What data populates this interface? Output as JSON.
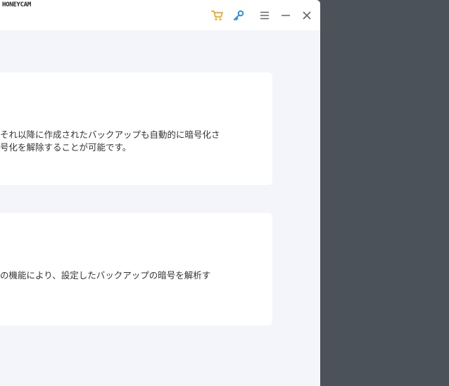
{
  "watermark": "HONEYCAM",
  "titlebar": {
    "icons": [
      "cart-icon",
      "key-icon",
      "menu-icon",
      "minimize-icon",
      "close-icon"
    ],
    "accent_cart": "#f5a623",
    "accent_key": "#2f8fe6"
  },
  "cards": [
    {
      "line1": "それ以降に作成されたバックアップも自動的に暗号化さ",
      "line2": "号化を解除することが可能です。"
    },
    {
      "line1": "の機能により、設定したバックアップの暗号を解析す"
    }
  ]
}
